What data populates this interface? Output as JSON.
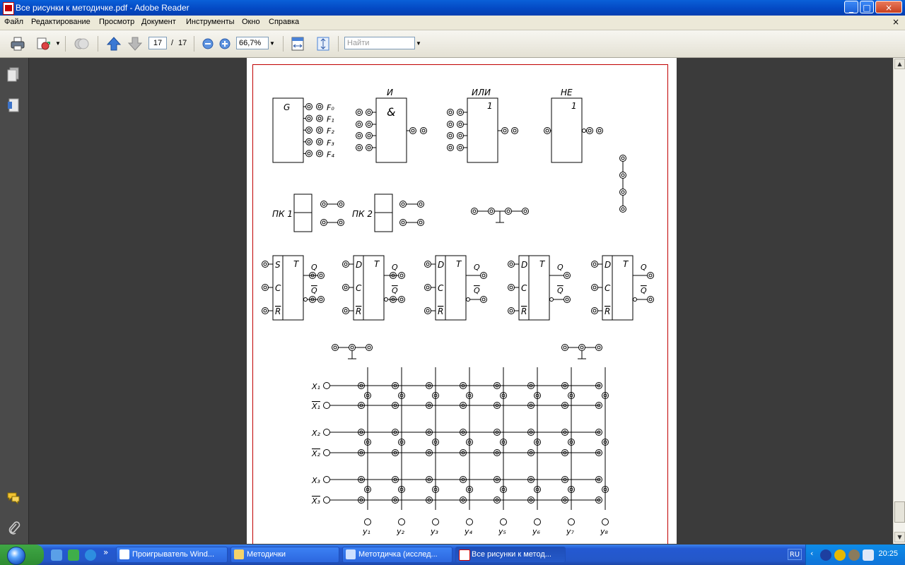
{
  "window": {
    "title": "Все рисунки к методичке.pdf - Adobe Reader",
    "min": "_",
    "max": "□",
    "close": "×"
  },
  "menu": [
    "Файл",
    "Редактирование",
    "Просмотр",
    "Документ",
    "Инструменты",
    "Окно",
    "Справка"
  ],
  "menu_close": "×",
  "toolbar": {
    "page_current": "17",
    "page_sep": "/",
    "page_total": "17",
    "zoom": "66,7%",
    "find_placeholder": "Найти"
  },
  "drawing": {
    "gen": {
      "label": "G",
      "outputs": [
        "F₀",
        "F₁",
        "F₂",
        "F₃",
        "F₄"
      ]
    },
    "and": {
      "title": "И",
      "symbol": "&"
    },
    "or": {
      "title": "ИЛИ",
      "symbol": "1"
    },
    "not": {
      "title": "НЕ",
      "symbol": "1"
    },
    "pk1": "ПК 1",
    "pk2": "ПК 2",
    "triggers": [
      {
        "in": [
          "S",
          "C",
          "R"
        ],
        "t": "T",
        "q": "Q",
        "nq": "Q"
      },
      {
        "in": [
          "D",
          "C",
          "R"
        ],
        "t": "T",
        "q": "Q",
        "nq": "Q"
      },
      {
        "in": [
          "D",
          "C",
          "R"
        ],
        "t": "T",
        "q": "Q",
        "nq": "Q"
      },
      {
        "in": [
          "D",
          "C",
          "R"
        ],
        "t": "T",
        "q": "Q",
        "nq": "Q"
      },
      {
        "in": [
          "D",
          "C",
          "R"
        ],
        "t": "T",
        "q": "Q",
        "nq": "Q"
      }
    ],
    "matrix": {
      "rows": [
        {
          "label": "X₁",
          "inv": false
        },
        {
          "label": "X₁",
          "inv": true
        },
        {
          "label": "X₂",
          "inv": false
        },
        {
          "label": "X₂",
          "inv": true
        },
        {
          "label": "X₃",
          "inv": false
        },
        {
          "label": "X₃",
          "inv": true
        }
      ],
      "cols": [
        "y₁",
        "y₂",
        "y₃",
        "y₄",
        "y₅",
        "y₆",
        "y₇",
        "y₈"
      ]
    }
  },
  "taskbar": {
    "tasks": [
      "Проигрыватель Wind...",
      "Методички",
      "Метотдичка (исслед...",
      "Все рисунки к метод..."
    ],
    "lang": "RU",
    "clock": "20:25"
  }
}
